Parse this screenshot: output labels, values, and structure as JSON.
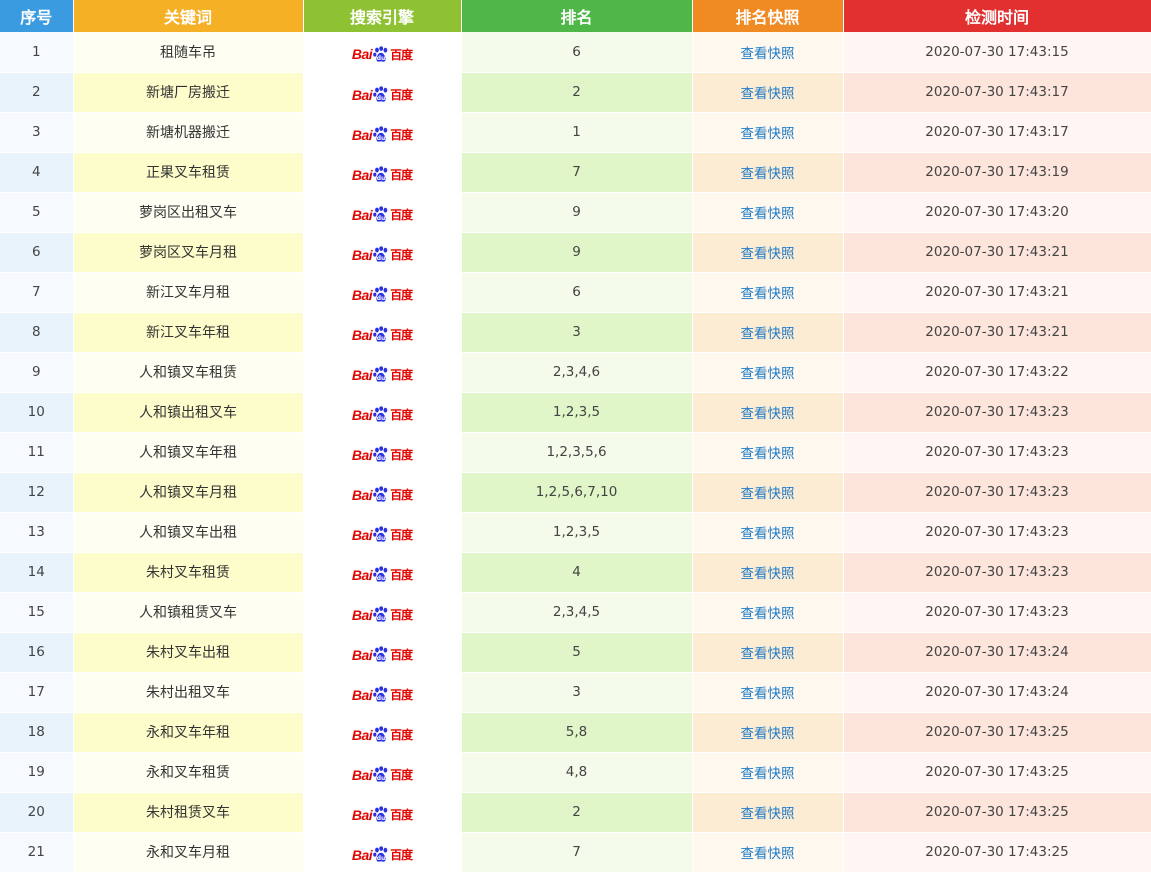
{
  "header": {
    "cols": [
      "序号",
      "关键词",
      "搜索引擎",
      "排名",
      "排名快照",
      "检测时间"
    ],
    "colors": [
      "#3a9be0",
      "#f6b025",
      "#8fc232",
      "#4eb747",
      "#f08a22",
      "#e23030"
    ]
  },
  "engine_logo": {
    "text_bai": "Bai",
    "text_du": "百度",
    "icon": "baidu-paw-icon"
  },
  "rows": [
    {
      "n": "1",
      "kw": "租随车吊",
      "rank": "6",
      "snap": "查看快照",
      "time": "2020-07-30 17:43:15"
    },
    {
      "n": "2",
      "kw": "新塘厂房搬迁",
      "rank": "2",
      "snap": "查看快照",
      "time": "2020-07-30 17:43:17"
    },
    {
      "n": "3",
      "kw": "新塘机器搬迁",
      "rank": "1",
      "snap": "查看快照",
      "time": "2020-07-30 17:43:17"
    },
    {
      "n": "4",
      "kw": "正果叉车租赁",
      "rank": "7",
      "snap": "查看快照",
      "time": "2020-07-30 17:43:19"
    },
    {
      "n": "5",
      "kw": "萝岗区出租叉车",
      "rank": "9",
      "snap": "查看快照",
      "time": "2020-07-30 17:43:20"
    },
    {
      "n": "6",
      "kw": "萝岗区叉车月租",
      "rank": "9",
      "snap": "查看快照",
      "time": "2020-07-30 17:43:21"
    },
    {
      "n": "7",
      "kw": "新江叉车月租",
      "rank": "6",
      "snap": "查看快照",
      "time": "2020-07-30 17:43:21"
    },
    {
      "n": "8",
      "kw": "新江叉车年租",
      "rank": "3",
      "snap": "查看快照",
      "time": "2020-07-30 17:43:21"
    },
    {
      "n": "9",
      "kw": "人和镇叉车租赁",
      "rank": "2,3,4,6",
      "snap": "查看快照",
      "time": "2020-07-30 17:43:22"
    },
    {
      "n": "10",
      "kw": "人和镇出租叉车",
      "rank": "1,2,3,5",
      "snap": "查看快照",
      "time": "2020-07-30 17:43:23"
    },
    {
      "n": "11",
      "kw": "人和镇叉车年租",
      "rank": "1,2,3,5,6",
      "snap": "查看快照",
      "time": "2020-07-30 17:43:23"
    },
    {
      "n": "12",
      "kw": "人和镇叉车月租",
      "rank": "1,2,5,6,7,10",
      "snap": "查看快照",
      "time": "2020-07-30 17:43:23"
    },
    {
      "n": "13",
      "kw": "人和镇叉车出租",
      "rank": "1,2,3,5",
      "snap": "查看快照",
      "time": "2020-07-30 17:43:23"
    },
    {
      "n": "14",
      "kw": "朱村叉车租赁",
      "rank": "4",
      "snap": "查看快照",
      "time": "2020-07-30 17:43:23"
    },
    {
      "n": "15",
      "kw": "人和镇租赁叉车",
      "rank": "2,3,4,5",
      "snap": "查看快照",
      "time": "2020-07-30 17:43:23"
    },
    {
      "n": "16",
      "kw": "朱村叉车出租",
      "rank": "5",
      "snap": "查看快照",
      "time": "2020-07-30 17:43:24"
    },
    {
      "n": "17",
      "kw": "朱村出租叉车",
      "rank": "3",
      "snap": "查看快照",
      "time": "2020-07-30 17:43:24"
    },
    {
      "n": "18",
      "kw": "永和叉车年租",
      "rank": "5,8",
      "snap": "查看快照",
      "time": "2020-07-30 17:43:25"
    },
    {
      "n": "19",
      "kw": "永和叉车租赁",
      "rank": "4,8",
      "snap": "查看快照",
      "time": "2020-07-30 17:43:25"
    },
    {
      "n": "20",
      "kw": "朱村租赁叉车",
      "rank": "2",
      "snap": "查看快照",
      "time": "2020-07-30 17:43:25"
    },
    {
      "n": "21",
      "kw": "永和叉车月租",
      "rank": "7",
      "snap": "查看快照",
      "time": "2020-07-30 17:43:25"
    }
  ],
  "column_tints": {
    "odd": [
      "#f6fafe",
      "#fefef2",
      "#ffffff",
      "#f5fbea",
      "#fff8ef",
      "#fff6f3"
    ],
    "even": [
      "#e9f3fc",
      "#fdfccb",
      "#ffffff",
      "#e1f6c8",
      "#fdecd4",
      "#fde5dc"
    ]
  }
}
